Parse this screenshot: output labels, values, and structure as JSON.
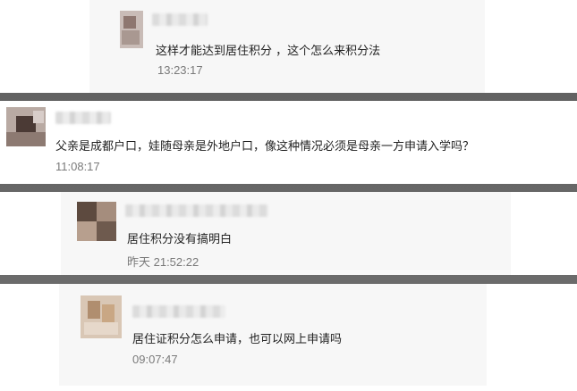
{
  "comments": [
    {
      "author": "",
      "text": "这样才能达到居住积分 ，这个怎么来积分法",
      "time": "13:23:17"
    },
    {
      "author": "",
      "text": "父亲是成都户口，娃随母亲是外地户口，像这种情况必须是母亲一方申请入学吗？",
      "time": "11:08:17"
    },
    {
      "author": "",
      "text": "居住积分没有搞明白",
      "time": "昨天 21:52:22"
    },
    {
      "author": "",
      "text": "居住证积分怎么申请，也可以网上申请吗",
      "time": "09:07:47"
    }
  ],
  "colors": {
    "background": "#666666",
    "card": "#ffffff",
    "inner": "#f7f7f7",
    "text": "#222222",
    "timestamp": "#7a7a7a"
  }
}
